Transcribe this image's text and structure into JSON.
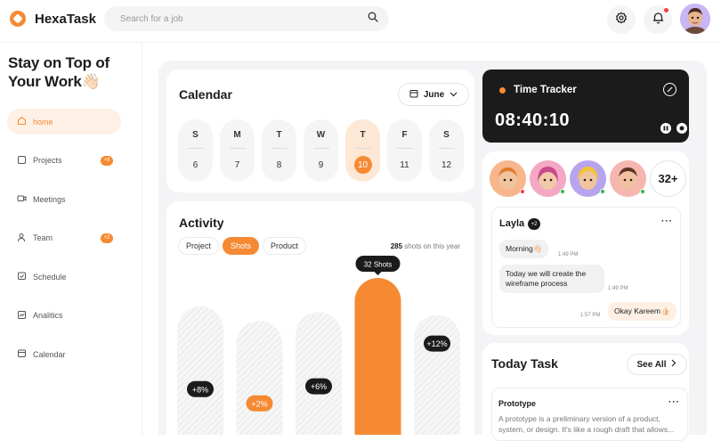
{
  "app": {
    "name": "HexaTask",
    "accent": "#f58a33"
  },
  "search": {
    "placeholder": "Search for a job"
  },
  "sidebar": {
    "headline_line1": "Stay on Top of",
    "headline_line2": "Your Work",
    "headline_emoji": "👋🏻",
    "items": [
      {
        "label": "home",
        "icon": "home-icon",
        "active": true
      },
      {
        "label": "Projects",
        "icon": "folder-icon",
        "badge": "+8"
      },
      {
        "label": "Meetings",
        "icon": "video-icon"
      },
      {
        "label": "Team",
        "icon": "user-icon",
        "badge": "+2"
      },
      {
        "label": "Schedule",
        "icon": "calendar-check-icon"
      },
      {
        "label": "Analitics",
        "icon": "chart-icon"
      },
      {
        "label": "Calendar",
        "icon": "calendar-icon"
      }
    ]
  },
  "calendar": {
    "title": "Calendar",
    "month": "June",
    "days": [
      {
        "name": "S",
        "date": "6"
      },
      {
        "name": "M",
        "date": "7"
      },
      {
        "name": "T",
        "date": "8"
      },
      {
        "name": "W",
        "date": "9"
      },
      {
        "name": "T",
        "date": "10",
        "active": true
      },
      {
        "name": "F",
        "date": "11"
      },
      {
        "name": "S",
        "date": "12"
      }
    ]
  },
  "activity": {
    "title": "Activity",
    "tabs": [
      "Project",
      "Shots",
      "Product"
    ],
    "active_tab": "Shots",
    "shots_count": "285",
    "shots_suffix": "shots on this year"
  },
  "chart_data": {
    "type": "bar",
    "title": "",
    "categories": [
      "",
      "",
      "",
      "",
      ""
    ],
    "values": [
      45,
      40,
      43,
      55,
      42
    ],
    "highlight_index": 3,
    "labels": [
      "+8%",
      "+2%",
      "+6%",
      "32 Shots",
      "+12%"
    ],
    "label_y_values": [
      16,
      11,
      17,
      60,
      32
    ],
    "ylim": [
      0,
      60
    ],
    "grid": false,
    "colors": {
      "highlight": "#f58a33",
      "bar": "#f0f0f0",
      "tooltip": "#1b1b1b"
    }
  },
  "tracker": {
    "title": "Time Tracker",
    "time": "08:40:10"
  },
  "team": {
    "avatars": [
      {
        "color": "#f7b68c",
        "status": "#ff3b3b"
      },
      {
        "color": "#f4a8c6",
        "status": "#2bb84a"
      },
      {
        "color": "#b8a4ee",
        "status": "#2bb84a"
      },
      {
        "color": "#f6b6b0",
        "status": "#2bb84a"
      }
    ],
    "more": "32+"
  },
  "chat": {
    "name": "Layla",
    "badge": "+2",
    "messages": [
      {
        "text": "Morning👋🏻",
        "time": "1:49 PM",
        "dir": "in"
      },
      {
        "text": "Today we will create the wireframe process",
        "time": "1:49 PM",
        "dir": "in"
      },
      {
        "text": "Okay Kareem👍🏻",
        "time": "1:57 PM",
        "dir": "out"
      }
    ]
  },
  "tasks": {
    "title": "Today Task",
    "see_all": "See All",
    "item": {
      "title": "Prototype",
      "description": "A prototype is a preliminary version of a product, system, or design. It's like a rough draft that allows..."
    }
  }
}
